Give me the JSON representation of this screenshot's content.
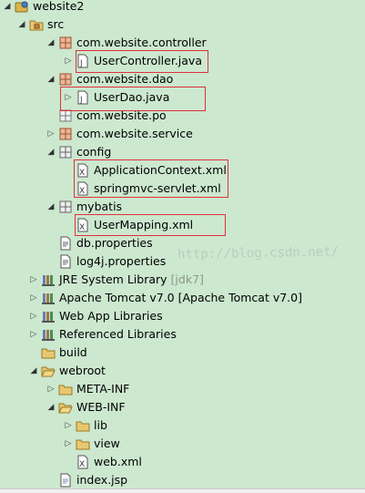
{
  "tree": {
    "root": "website2",
    "src": "src",
    "pkg_controller": "com.website.controller",
    "file_usercontroller": "UserController.java",
    "pkg_dao": "com.website.dao",
    "file_userdao": "UserDao.java",
    "pkg_po": "com.website.po",
    "pkg_service": "com.website.service",
    "config": "config",
    "file_appctx": "ApplicationContext.xml",
    "file_springmvc": "springmvc-servlet.xml",
    "mybatis": "mybatis",
    "file_usermapping": "UserMapping.xml",
    "file_db": "db.properties",
    "file_log4j": "log4j.properties",
    "jre_label": "JRE System Library",
    "jre_decor": "[jdk7]",
    "tomcat": "Apache Tomcat v7.0 [Apache Tomcat v7.0]",
    "webapp_libs": "Web App Libraries",
    "ref_libs": "Referenced Libraries",
    "build": "build",
    "webroot": "webroot",
    "metainf": "META-INF",
    "webinf": "WEB-INF",
    "lib": "lib",
    "view": "view",
    "webxml": "web.xml",
    "indexjsp": "index.jsp"
  },
  "watermark": "http://blog.csdn.net/",
  "colors": {
    "background": "#cce8cf",
    "highlight_border": "#e0303a",
    "decoration_text": "#8a9a8a"
  }
}
